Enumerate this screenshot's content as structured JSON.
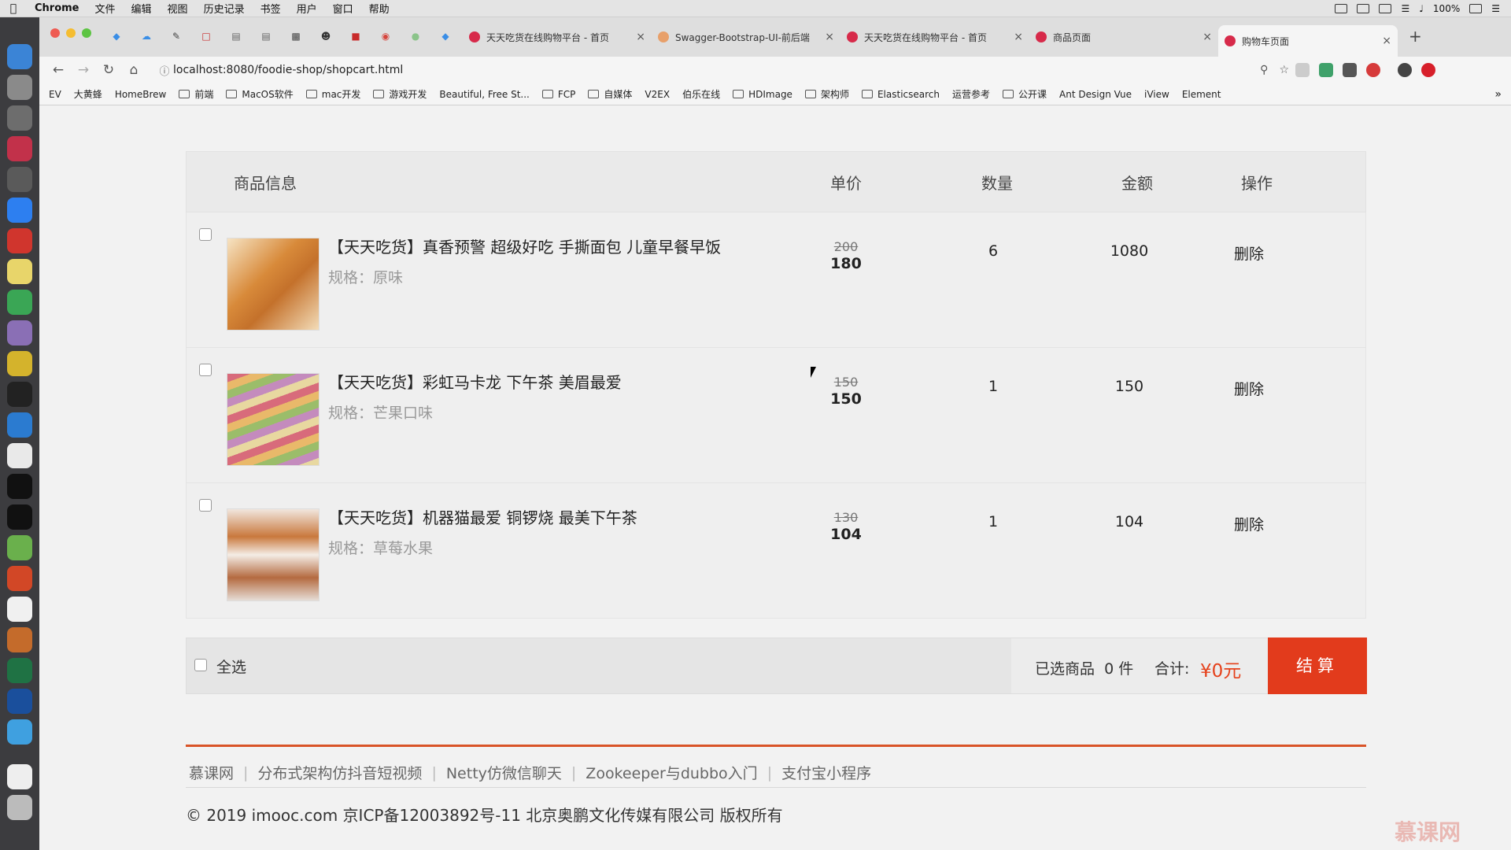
{
  "menubar": {
    "app": "Chrome",
    "items": [
      "文件",
      "编辑",
      "视图",
      "历史记录",
      "书签",
      "用户",
      "窗口",
      "帮助"
    ],
    "battery": "100%"
  },
  "tabs": [
    {
      "title": "天天吃货在线购物平台 - 首页",
      "fav": "#d72a4a"
    },
    {
      "title": "Swagger-Bootstrap-UI-前后端",
      "fav": "#e8a06a"
    },
    {
      "title": "天天吃货在线购物平台 - 首页",
      "fav": "#d72a4a"
    },
    {
      "title": "商品页面",
      "fav": "#d72a4a"
    },
    {
      "title": "购物车页面",
      "fav": "#d72a4a"
    }
  ],
  "address": "localhost:8080/foodie-shop/shopcart.html",
  "bookmarks": [
    "EV",
    "大黄蜂",
    "HomeBrew",
    "前端",
    "MacOS软件",
    "mac开发",
    "游戏开发",
    "Beautiful, Free St...",
    "FCP",
    "自媒体",
    "V2EX",
    "伯乐在线",
    "HDImage",
    "架构师",
    "Elasticsearch",
    "运营参考",
    "公开课",
    "Ant Design Vue",
    "iView",
    "Element"
  ],
  "cart": {
    "headers": {
      "info": "商品信息",
      "price": "单价",
      "qty": "数量",
      "amount": "金额",
      "op": "操作"
    },
    "items": [
      {
        "name": "【天天吃货】真香预警 超级好吃 手撕面包 儿童早餐早饭",
        "spec": "规格：原味",
        "old_price": "200",
        "price": "180",
        "qty": "6",
        "amount": "1080",
        "action": "删除"
      },
      {
        "name": "【天天吃货】彩虹马卡龙 下午茶 美眉最爱",
        "spec": "规格：芒果口味",
        "old_price": "150",
        "price": "150",
        "qty": "1",
        "amount": "150",
        "action": "删除"
      },
      {
        "name": "【天天吃货】机器猫最爱 铜锣烧 最美下午茶",
        "spec": "规格：草莓水果",
        "old_price": "130",
        "price": "104",
        "qty": "1",
        "amount": "104",
        "action": "删除"
      }
    ],
    "select_all": "全选",
    "selected_label": "已选商品",
    "selected_count": "0 件",
    "total_label": "合计:",
    "total_value": "¥0元",
    "checkout": "结算"
  },
  "footer": {
    "links": [
      "慕课网",
      "分布式架构仿抖音短视频",
      "Netty仿微信聊天",
      "Zookeeper与dubbo入门",
      "支付宝小程序"
    ],
    "copyright": "© 2019 imooc.com 京ICP备12003892号-11 北京奥鹏文化传媒有限公司 版权所有"
  },
  "watermark": "慕课网"
}
